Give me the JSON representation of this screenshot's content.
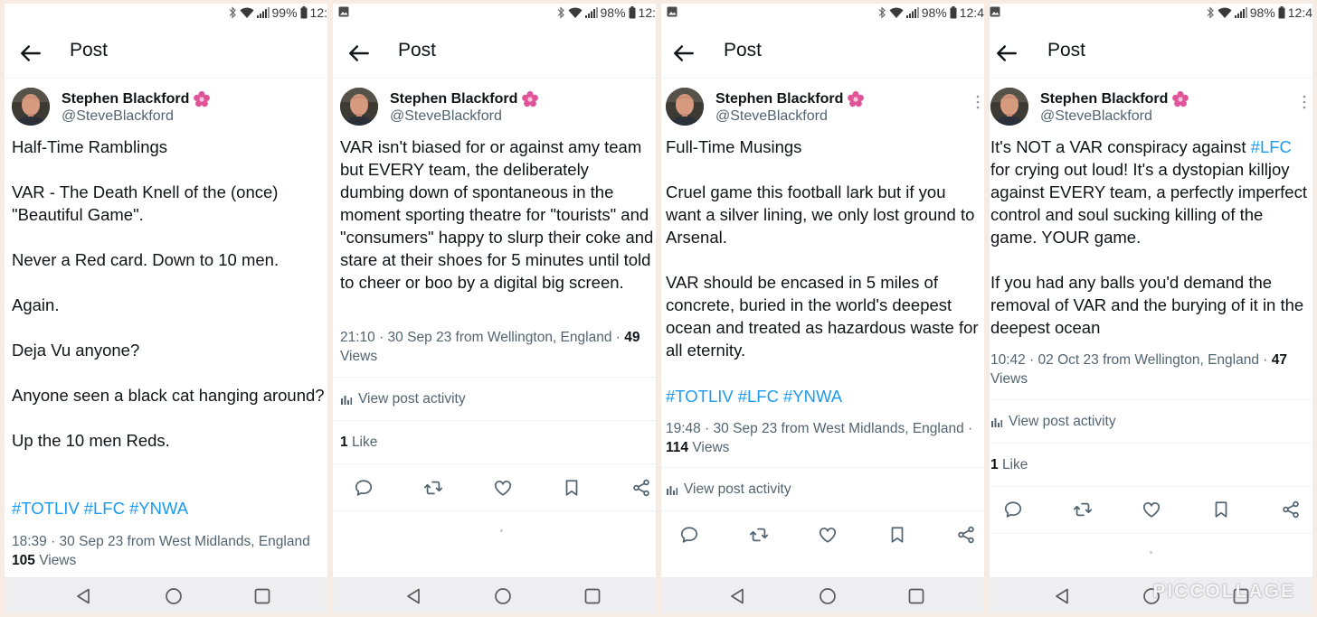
{
  "colors": {
    "link": "#1d9bf0",
    "text": "#0f1419",
    "secondary": "#536471",
    "nav_bar": "#eeeef0",
    "collage_bg": "#f7ece4"
  },
  "header_title": "Post",
  "author": {
    "name": "Stephen Blackford",
    "handle": "@SteveBlackford",
    "badge_icon": "pink-flower-icon"
  },
  "icons": {
    "back": "arrow-left-icon",
    "reply": "speech-bubble-icon",
    "repost": "repost-arrows-icon",
    "like": "heart-icon",
    "bookmark": "bookmark-icon",
    "share": "share-icon",
    "activity": "bar-chart-icon"
  },
  "screens": [
    {
      "status": {
        "battery": "99%",
        "time": "12:"
      },
      "paragraphs": [
        "Half-Time Ramblings",
        "VAR - The Death Knell of the (once) \"Beautiful Game\".",
        "Never a Red card. Down to 10 men.",
        "Again.",
        "Deja Vu anyone?",
        "Anyone seen a black cat hanging around?",
        "Up the 10 men Reds."
      ],
      "hashtags": [
        "#TOTLIV",
        "#LFC",
        "#YNWA"
      ],
      "timestamp": "18:39 · 30 Sep 23 from West Midlands, England",
      "views_count": "105",
      "views_label": "Views"
    },
    {
      "status": {
        "battery": "98%",
        "time": "12:"
      },
      "paragraphs": [
        "VAR isn't biased for or against amy team but EVERY team, the deliberately dumbing down of spontaneous in the moment sporting theatre for \"tourists\" and \"consumers\" happy to slurp their coke and stare at their shoes for 5 minutes until told to cheer or boo by a digital big screen."
      ],
      "timestamp": "21:10 · 30 Sep 23 from Wellington, England · ",
      "views_count": "49",
      "views_label": "Views",
      "activity_label": "View post activity",
      "likes_count": "1",
      "likes_label": "Like"
    },
    {
      "status": {
        "battery": "98%",
        "time": "12:4"
      },
      "paragraphs": [
        "Full-Time Musings",
        "Cruel game this football lark but if you want a silver lining, we only lost ground to Arsenal.",
        "VAR should be encased in 5 miles of concrete, buried in the world's deepest ocean and treated as hazardous waste for all eternity."
      ],
      "hashtags": [
        "#TOTLIV",
        "#LFC",
        "#YNWA"
      ],
      "timestamp": "19:48 · 30 Sep 23 from West Midlands, England ·",
      "views_count": "114",
      "views_label": "Views",
      "activity_label": "View post activity"
    },
    {
      "status": {
        "battery": "98%",
        "time": "12:4"
      },
      "p1_before": "It's NOT a VAR conspiracy against ",
      "p1_tag": "#LFC",
      "p1_after": " for crying out loud! It's a dystopian killjoy against EVERY team, a perfectly imperfect control and soul sucking killing of the game. YOUR game.",
      "p2": "If you had any balls you'd demand the removal of VAR and the burying of it in the deepest ocean",
      "timestamp": "10:42 · 02 Oct 23 from Wellington, England · ",
      "views_count": "47",
      "views_label": "Views",
      "activity_label": "View post activity",
      "likes_count": "1",
      "likes_label": "Like"
    }
  ],
  "watermark": "PICCOLLAGE"
}
